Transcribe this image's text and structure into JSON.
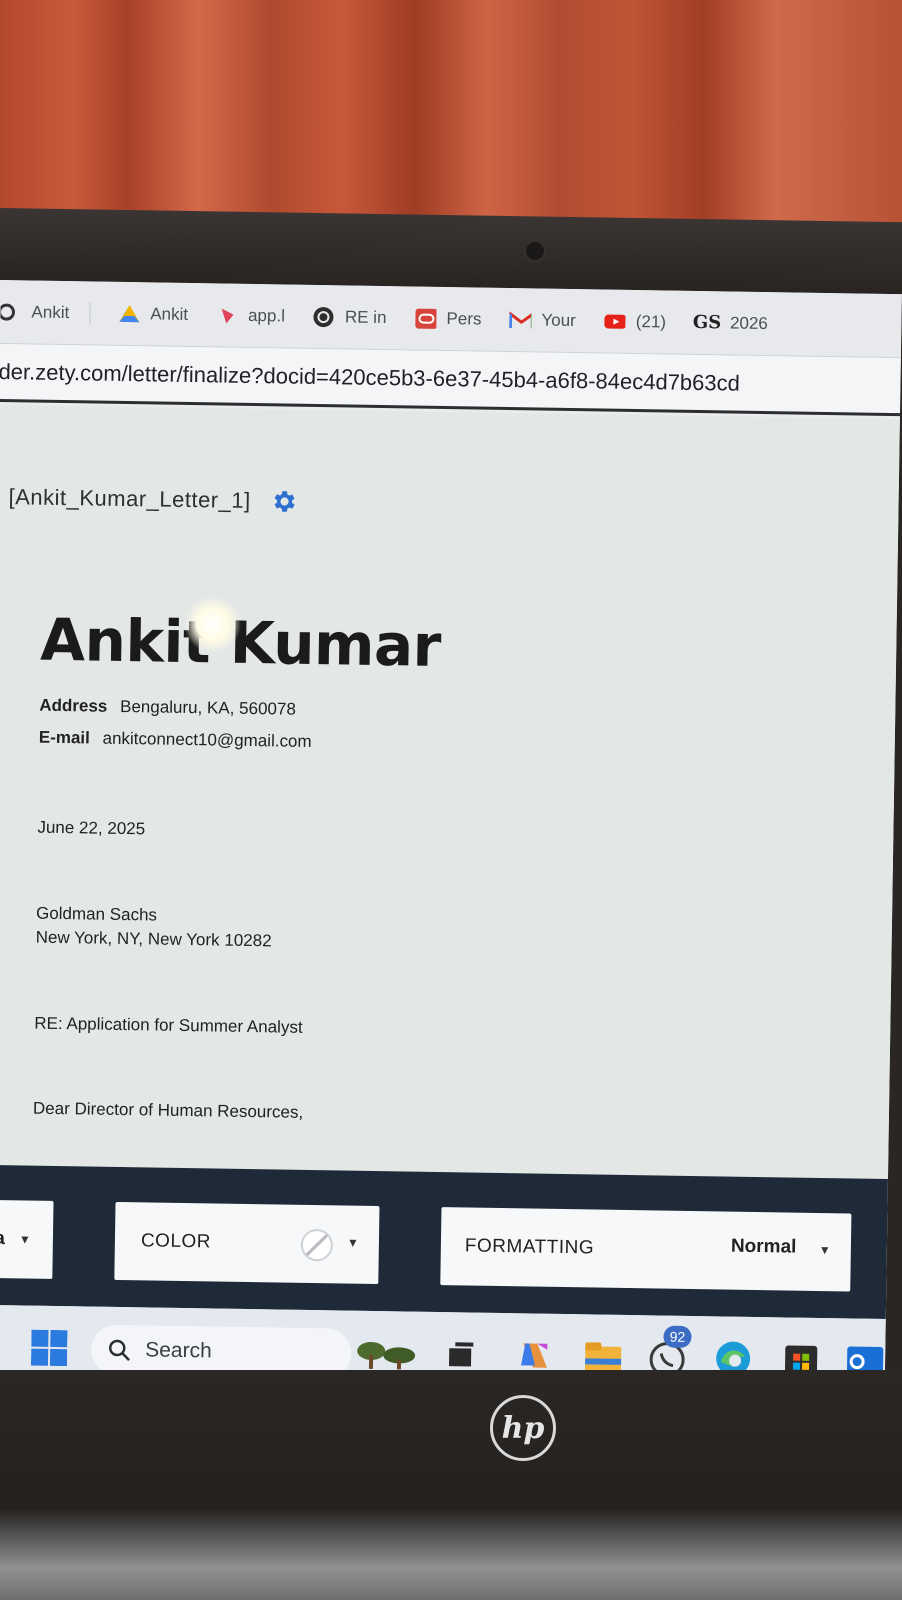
{
  "browser": {
    "tabs": [
      {
        "icon": "circle-icon",
        "label": "Ankit"
      },
      {
        "icon": "google-drive-icon",
        "label": "Ankit"
      },
      {
        "icon": "app-icon",
        "label": "app.l"
      },
      {
        "icon": "chatgpt-icon",
        "label": "RE in"
      },
      {
        "icon": "oracle-icon",
        "label": "Pers"
      },
      {
        "icon": "gmail-icon",
        "label": "Your"
      },
      {
        "icon": "youtube-icon",
        "label": "(21)"
      },
      {
        "icon": "gs-icon",
        "label": "2026"
      }
    ],
    "url": "der.zety.com/letter/finalize?docid=420ce5b3-6e37-45b4-a6f8-84ec4d7b63cd"
  },
  "document": {
    "file_name": "[Ankit_Kumar_Letter_1]",
    "name": "Ankit Kumar",
    "address_label": "Address",
    "address_value": "Bengaluru, KA, 560078",
    "email_label": "E-mail",
    "email_value": "ankitconnect10@gmail.com",
    "date": "June 22, 2025",
    "recipient_company": "Goldman Sachs",
    "recipient_address": "New York, NY, New York 10282",
    "subject": "RE: Application for Summer Analyst",
    "salutation": "Dear Director of Human Resources,"
  },
  "toolbar": {
    "font_partial": "ra",
    "color_label": "COLOR",
    "formatting_label": "FORMATTING",
    "formatting_value": "Normal"
  },
  "taskbar": {
    "search_label": "Search",
    "whatsapp_badge": "92"
  },
  "colors": {
    "accent_blue": "#2f6fd1",
    "toolbar_bg": "#1f2a38"
  }
}
